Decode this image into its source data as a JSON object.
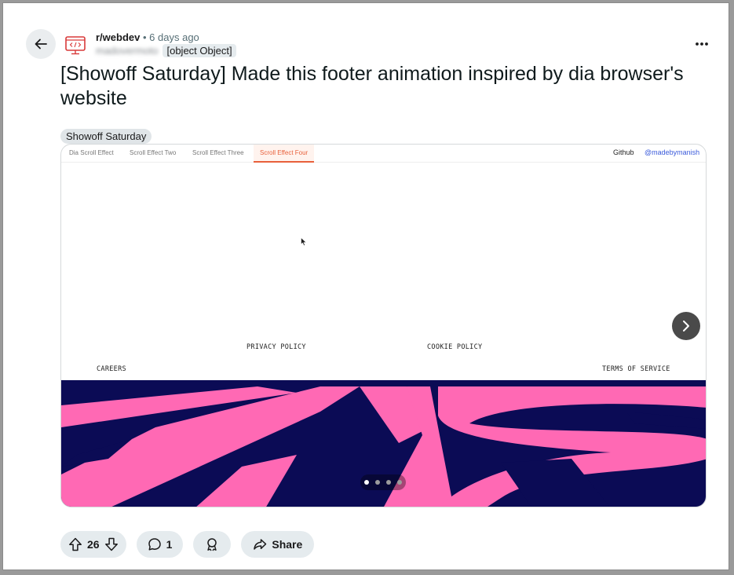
{
  "post": {
    "subreddit": "r/webdev",
    "separator": "•",
    "time_ago": "6 days ago",
    "username": "madovermoto",
    "user_tag": "[object Object]",
    "title": "[Showoff Saturday] Made this footer animation inspired by dia browser's website",
    "flair": "Showoff Saturday"
  },
  "media": {
    "nav_tabs": [
      {
        "label": "Dia Scroll Effect"
      },
      {
        "label": "Scroll Effect Two"
      },
      {
        "label": "Scroll Effect Three"
      },
      {
        "label": "Scroll Effect Four"
      }
    ],
    "active_tab": 3,
    "nav_right": {
      "github": "Github",
      "handle": "@madebymanish"
    },
    "footer_links": {
      "careers": "CAREERS",
      "privacy": "PRIVACY POLICY",
      "cookie": "COOKIE POLICY",
      "terms": "TERMS OF SERVICE"
    },
    "slides_total": 4,
    "slide_active": 1,
    "colors": {
      "pink": "#ff69b4",
      "navy": "#0b0b55",
      "active_tab": "#e8603b",
      "handle": "#3b5bdb"
    }
  },
  "actions": {
    "upvotes": "26",
    "comments": "1",
    "share": "Share"
  },
  "icons": {
    "back": "arrow-left-icon",
    "more": "more-horizontal-icon",
    "upvote": "upvote-arrow-icon",
    "downvote": "downvote-arrow-icon",
    "comment": "comment-bubble-icon",
    "award": "award-icon",
    "share": "share-arrow-icon",
    "next": "chevron-right-icon"
  }
}
